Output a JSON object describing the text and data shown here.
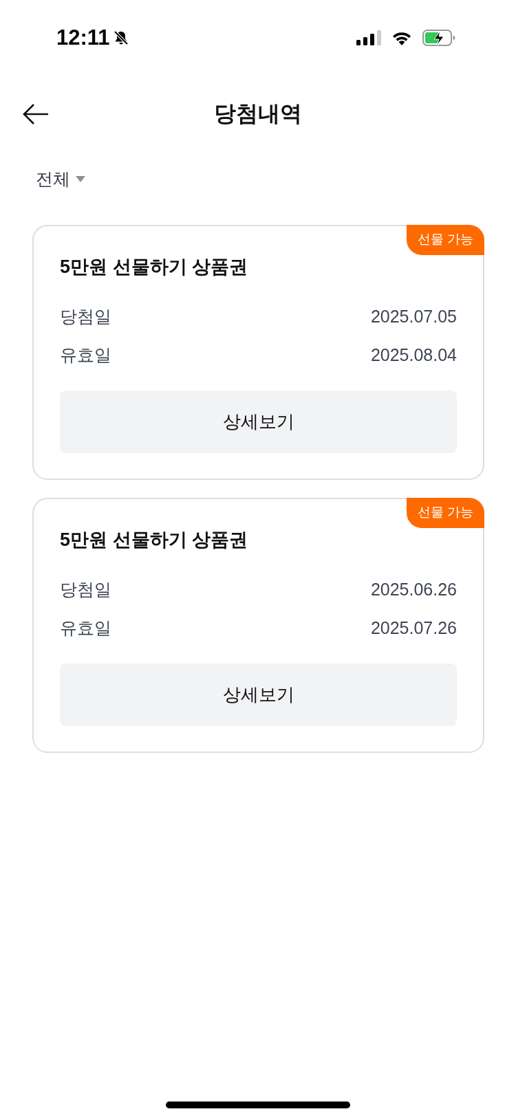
{
  "status_bar": {
    "time": "12:11"
  },
  "header": {
    "title": "당첨내역"
  },
  "filter": {
    "label": "전체"
  },
  "cards": [
    {
      "badge": "선물 가능",
      "title": "5만원 선물하기 상품권",
      "rows": [
        {
          "label": "당첨일",
          "value": "2025.07.05"
        },
        {
          "label": "유효일",
          "value": "2025.08.04"
        }
      ],
      "button": "상세보기"
    },
    {
      "badge": "선물 가능",
      "title": "5만원 선물하기 상품권",
      "rows": [
        {
          "label": "당첨일",
          "value": "2025.06.26"
        },
        {
          "label": "유효일",
          "value": "2025.07.26"
        }
      ],
      "button": "상세보기"
    }
  ]
}
